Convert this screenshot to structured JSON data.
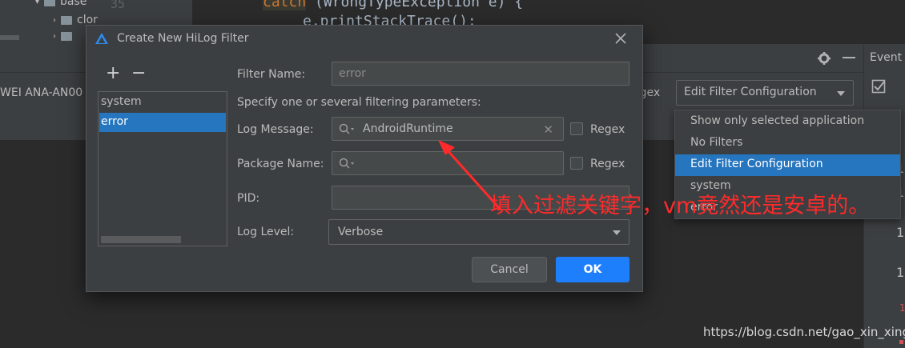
{
  "background": {
    "tree_folder_1": "base",
    "tree_folder_2": "clor",
    "code_line_1_keyword": "catch",
    "code_line_1_rest": " (WrongTypeException e) {",
    "code_line_2": "e.printStackTrace();",
    "line_number": "35",
    "device_label": "WEI ANA-AN00",
    "regex_label": "egex",
    "filter_combo_value": "Edit Filter Configuration",
    "event_log_label": "Event L",
    "gutter_ones": [
      "1",
      "1",
      "1",
      "1",
      "1"
    ]
  },
  "popup": {
    "items": [
      "Show only selected application",
      "No Filters",
      "Edit Filter Configuration",
      "system",
      "error"
    ],
    "selected_index": 2
  },
  "dialog": {
    "title": "Create New HiLog Filter",
    "list": {
      "items": [
        "system",
        "error"
      ],
      "selected_index": 1
    },
    "filter_name": {
      "label": "Filter Name:",
      "value": "error"
    },
    "hint": "Specify one or several filtering parameters:",
    "log_message": {
      "label": "Log Message:",
      "value": "AndroidRuntime",
      "regex_label": "Regex"
    },
    "package_name": {
      "label": "Package Name:",
      "value": "",
      "regex_label": "Regex"
    },
    "pid": {
      "label": "PID:",
      "value": ""
    },
    "log_level": {
      "label": "Log Level:",
      "value": "Verbose"
    },
    "cancel_label": "Cancel",
    "ok_label": "OK"
  },
  "annotation": "填入过滤关键字，vm竟然还是安卓的。",
  "watermark": "https://blog.csdn.net/gao_xin_xing",
  "colors": {
    "accent": "#2675bf",
    "ok_button": "#1e7ffd",
    "annotation": "#ff2a2a"
  }
}
